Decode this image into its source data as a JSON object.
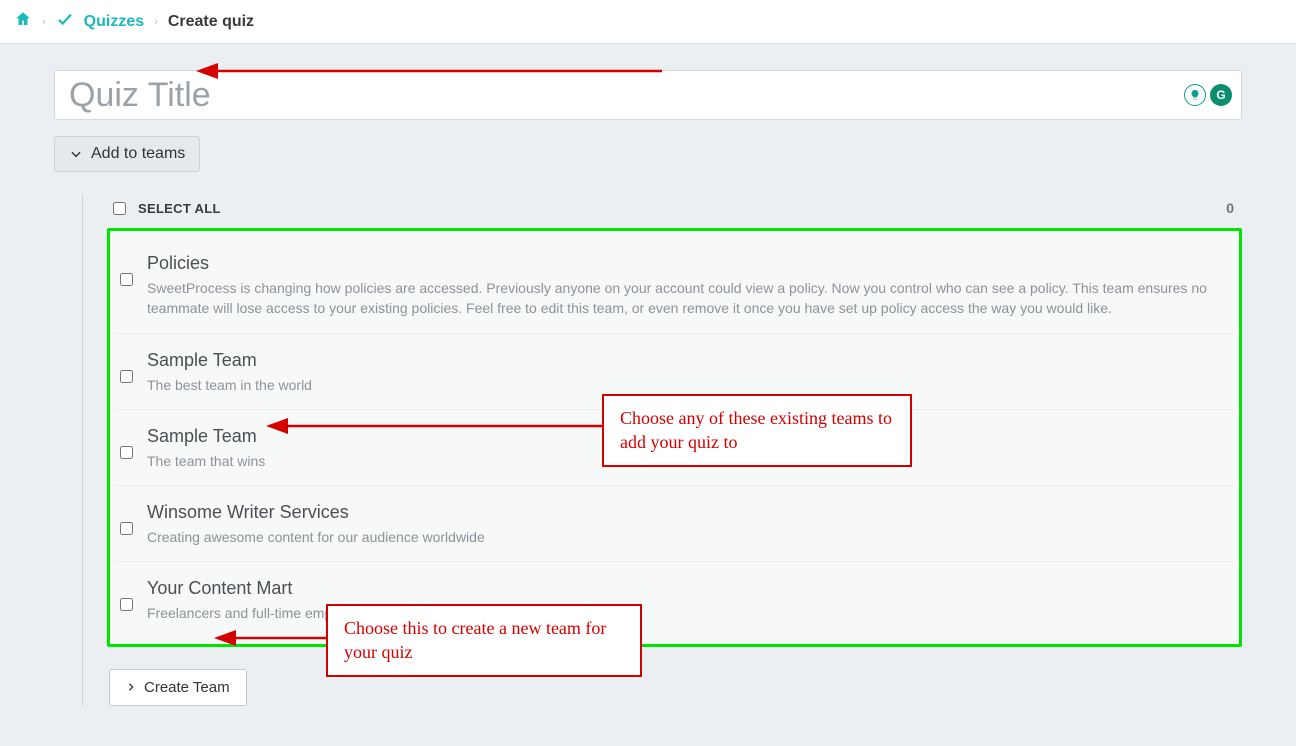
{
  "breadcrumb": {
    "quizzes": "Quizzes",
    "current": "Create quiz"
  },
  "title_placeholder": "Quiz Title",
  "add_teams_label": "Add to teams",
  "select_all_label": "Select all",
  "selected_count": "0",
  "teams": [
    {
      "title": "Policies",
      "desc": "SweetProcess is changing how policies are accessed. Previously anyone on your account could view a policy. Now you control who can see a policy. This team ensures no teammate will lose access to your existing policies. Feel free to edit this team, or even remove it once you have set up policy access the way you would like."
    },
    {
      "title": "Sample Team",
      "desc": "The best team in the world"
    },
    {
      "title": "Sample Team",
      "desc": "The team that wins"
    },
    {
      "title": "Winsome Writer Services",
      "desc": "Creating awesome content for our audience worldwide"
    },
    {
      "title": "Your Content Mart",
      "desc": "Freelancers and full-time employees of our agency"
    }
  ],
  "create_team_label": "Create Team",
  "annotations": {
    "choose_existing": "Choose any of these existing teams to add your quiz to",
    "choose_create": "Choose this to create a new team for your quiz"
  },
  "icons": {
    "home": "home-icon",
    "check": "check-icon",
    "chevron_down": "chevron-down-icon",
    "chevron_right": "chevron-right-icon",
    "lightbulb": "lightbulb-icon",
    "grammarly": "grammarly-icon"
  }
}
